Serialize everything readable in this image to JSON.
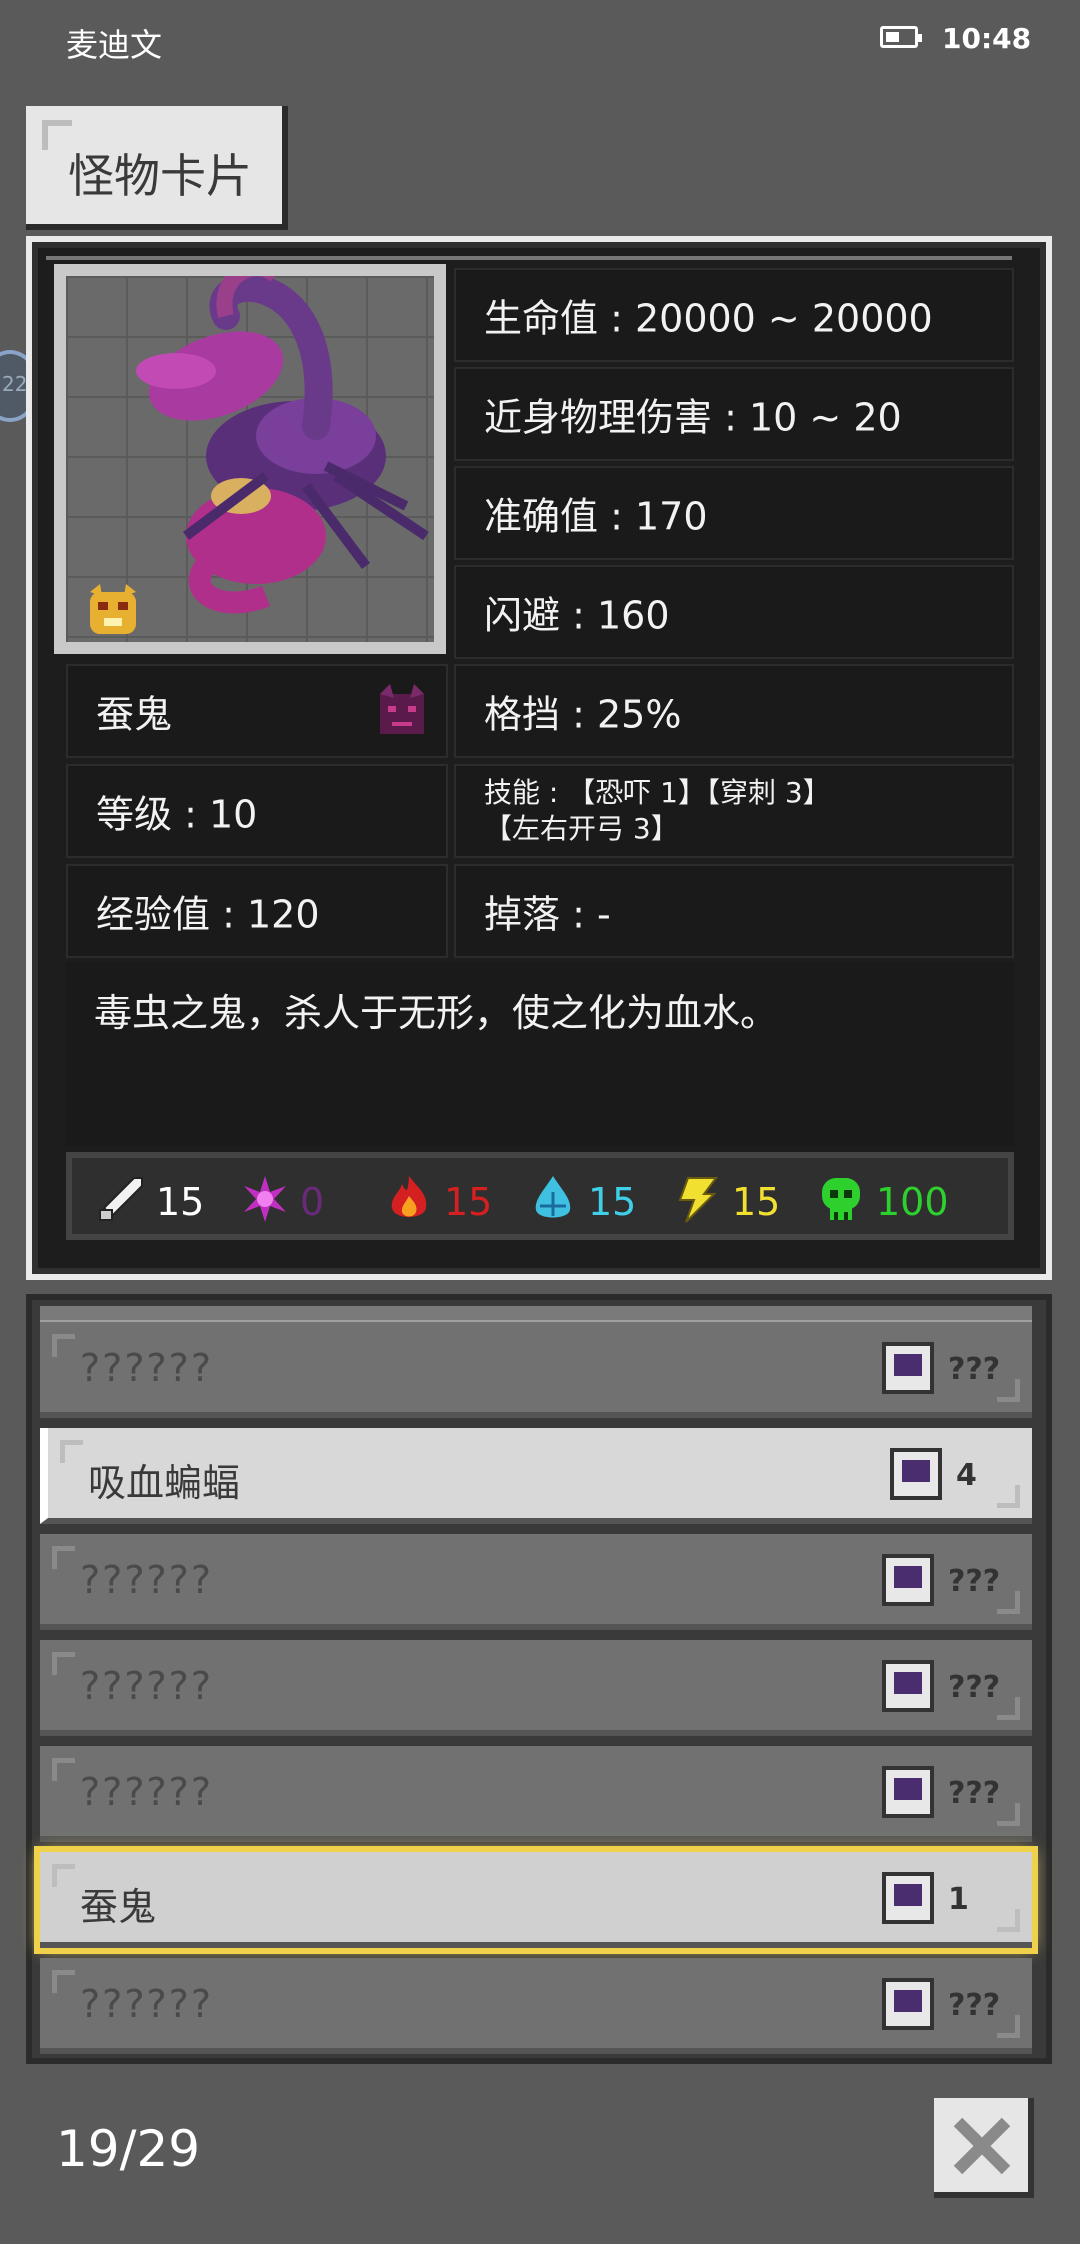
{
  "status_bar": {
    "carrier": "麦迪文",
    "time": "10:48"
  },
  "title": "怪物卡片",
  "side_bubble": "22",
  "monster": {
    "name": "蚕鬼",
    "level": "等级 : 10",
    "exp": "经验值 : 120",
    "hp": "生命值 : 20000 ~ 20000",
    "melee": "近身物理伤害 : 10 ~ 20",
    "accuracy": "准确值 : 170",
    "dodge": "闪避 : 160",
    "block": "格挡 : 25%",
    "skills": "技能 : 【恐吓 1】【穿刺 3】【左右开弓 3】",
    "drop": "掉落 : -",
    "description": "毒虫之鬼，杀人于无形，使之化为血水。"
  },
  "resistances": [
    {
      "icon": "sword-icon",
      "value": "15",
      "color": "#ffffff"
    },
    {
      "icon": "magic-star-icon",
      "value": "0",
      "color": "#6a2a7a"
    },
    {
      "icon": "fire-icon",
      "value": "15",
      "color": "#d42020"
    },
    {
      "icon": "water-icon",
      "value": "15",
      "color": "#3fd0e8"
    },
    {
      "icon": "lightning-icon",
      "value": "15",
      "color": "#f2e030"
    },
    {
      "icon": "poison-skull-icon",
      "value": "100",
      "color": "#2ed02e"
    }
  ],
  "list": [
    {
      "name": "??????",
      "count": "???"
    },
    {
      "name": "吸血蝙蝠",
      "count": "4"
    },
    {
      "name": "??????",
      "count": "???"
    },
    {
      "name": "??????",
      "count": "???"
    },
    {
      "name": "??????",
      "count": "???"
    },
    {
      "name": "蚕鬼",
      "count": "1"
    },
    {
      "name": "??????",
      "count": "???"
    }
  ],
  "page_count": "19/29"
}
